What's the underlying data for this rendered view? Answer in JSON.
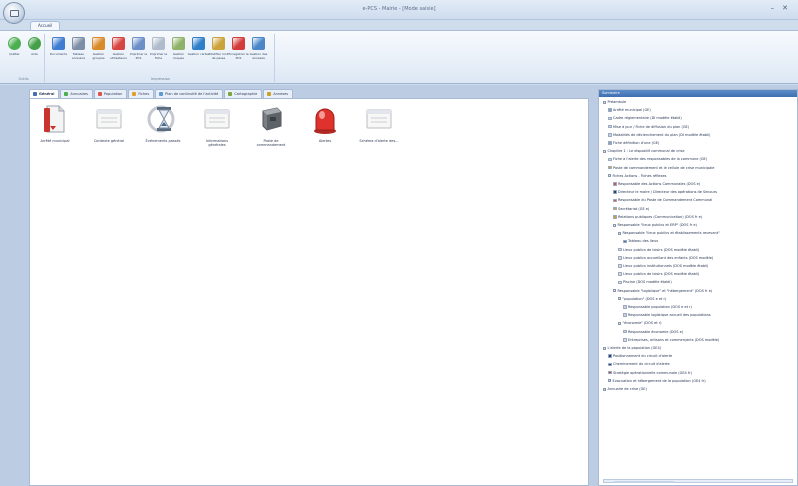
{
  "window": {
    "title": "e-PCS - Mairie - [Mode saisie]",
    "minimize": "–",
    "close": "✕"
  },
  "ribbon": {
    "tab_label": "Accueil",
    "groups": [
      {
        "title": "Outils",
        "buttons": [
          {
            "label": "Quitter",
            "icon": "exit-icon",
            "color": "#4caf50"
          },
          {
            "label": "Aide",
            "icon": "help-icon",
            "color": "#43a047"
          }
        ]
      },
      {
        "title": "Impression",
        "buttons": [
          {
            "label": "Documents",
            "icon": "documents-icon",
            "color": "#3f7dd1"
          },
          {
            "label": "Tableau annuaire",
            "icon": "directory-icon",
            "color": "#7e8ea6"
          },
          {
            "label": "Gestion groupes",
            "icon": "groups-icon",
            "color": "#d98b2b"
          },
          {
            "label": "Gestion utilisateurs",
            "icon": "users-icon",
            "color": "#d64541"
          },
          {
            "label": "Imprimer le PCS",
            "icon": "print-icon",
            "color": "#6d8fc7"
          },
          {
            "label": "Imprimer la fiche",
            "icon": "print-sheet-icon",
            "color": "#b0bccb"
          },
          {
            "label": "Gestion risques",
            "icon": "risks-icon",
            "color": "#8fb26a"
          },
          {
            "label": "Gestion cartes",
            "icon": "maps-icon",
            "color": "#2f7fc9"
          },
          {
            "label": "Modifier mot de passe",
            "icon": "password-icon",
            "color": "#caa43a"
          },
          {
            "label": "Enregistrer le PCS",
            "icon": "save-pcs-icon",
            "color": "#d33b3b"
          },
          {
            "label": "Gestion des annexes",
            "icon": "annexes-icon",
            "color": "#4a86c8"
          }
        ]
      }
    ]
  },
  "doc_tabs": [
    {
      "label": "Général",
      "color": "#3f6fb0",
      "active": true
    },
    {
      "label": "Annuaires",
      "color": "#4caf50",
      "active": false
    },
    {
      "label": "Population",
      "color": "#d9534f",
      "active": false
    },
    {
      "label": "Fiches",
      "color": "#e0a030",
      "active": false
    },
    {
      "label": "Plan de continuité de l'activité",
      "color": "#5b9bd5",
      "active": false
    },
    {
      "label": "Cartographie",
      "color": "#7aa63c",
      "active": false
    },
    {
      "label": "Annexes",
      "color": "#c9a227",
      "active": false
    }
  ],
  "grid_items": [
    {
      "label": "Arrêté municipal",
      "icon": "decree-icon"
    },
    {
      "label": "Contexte général",
      "icon": "context-icon"
    },
    {
      "label": "Événements passés",
      "icon": "hourglass-icon"
    },
    {
      "label": "Informations générales",
      "icon": "info-icon"
    },
    {
      "label": "Poste de commandement",
      "icon": "command-post-icon"
    },
    {
      "label": "Alertes",
      "icon": "alert-siren-icon"
    },
    {
      "label": "Schéma d'alerte des...",
      "icon": "alert-scheme-icon"
    }
  ],
  "panel": {
    "title": "Sommaire",
    "tree": [
      {
        "level": 0,
        "label": "Préambule",
        "exp": "−"
      },
      {
        "level": 1,
        "label": "Arrêté municipal (GE)",
        "c": "#8aa0bf"
      },
      {
        "level": 1,
        "label": "Cadre réglementaire (DI modèle établi)",
        "c": "#c8d3e3"
      },
      {
        "level": 1,
        "label": "Mise à jour / Fiche de diffusion du plan (GE)",
        "c": "#c8d3e3"
      },
      {
        "level": 1,
        "label": "Modalités de déclenchement du plan (DI modèle établi)",
        "c": "#c8d3e3"
      },
      {
        "level": 1,
        "label": "Fiche définition d'une (GE)",
        "c": "#8aa0bf"
      },
      {
        "level": 0,
        "label": "Chapitre 1 : Le dispositif communal de crise",
        "exp": "−"
      },
      {
        "level": 1,
        "label": "Fiche à l'alerte des responsables de la commune (GE)",
        "c": "#c8d3e3"
      },
      {
        "level": 1,
        "label": "Poste de commandement et le cellule de crise municipale",
        "c": "#e0a030"
      },
      {
        "level": 1,
        "label": "Fiches Actions - Fiches réflexes",
        "exp": "−"
      },
      {
        "level": 2,
        "label": "Responsable des Actions Communales (DOS e)",
        "c": "#d9534f"
      },
      {
        "level": 2,
        "label": "Directeur le maire / Directeur des opérations de Secours",
        "c": "#1f3f7a"
      },
      {
        "level": 2,
        "label": "Responsable du Poste de Commandement Communal",
        "c": "#d9534f"
      },
      {
        "level": 2,
        "label": "Secrétariat (GE e)",
        "c": "#e0a030"
      },
      {
        "level": 2,
        "label": "Relations publiques (Communication) (DOS fr e)",
        "c": "#c8a040"
      },
      {
        "level": 2,
        "label": "Responsable \"lieux publics et ERP\" (DOS fr e)",
        "exp": "−"
      },
      {
        "level": 3,
        "label": "Responsable \"lieux publics et établissements recevant\"",
        "exp": "−"
      },
      {
        "level": 4,
        "label": "Tableau des lieux",
        "c": "#3f6fb0"
      },
      {
        "level": 3,
        "label": "Lieux publics de loisirs (DOS modèle établi)"
      },
      {
        "level": 3,
        "label": "Lieux publics accueillant des enfants (DOS modèle)"
      },
      {
        "level": 3,
        "label": "Lieux publics institutionnels (DOS modèle établi)"
      },
      {
        "level": 3,
        "label": "Lieux publics de loisirs (DOS modèle établi)"
      },
      {
        "level": 3,
        "label": "Piscine (DOS modèle établi)"
      },
      {
        "level": 2,
        "label": "Responsable \"logistique\" et \"hébergement\" (DOS fr e)",
        "exp": "−"
      },
      {
        "level": 3,
        "label": "\"population\" (DOS e et r)",
        "exp": "−"
      },
      {
        "level": 4,
        "label": "Responsable population (DOS e et r)",
        "c": "#c8d3e3"
      },
      {
        "level": 4,
        "label": "Responsable logistique accueil des populations",
        "c": "#c8d3e3"
      },
      {
        "level": 3,
        "label": "\"économie\" (DOS et r)",
        "exp": "−"
      },
      {
        "level": 4,
        "label": "Responsable économie (DOS e)",
        "c": "#c8d3e3"
      },
      {
        "level": 4,
        "label": "Entreprises, artisans et commerçants (DOS modèle)"
      },
      {
        "level": 0,
        "label": "L'alerte de la population (GE4)",
        "exp": "−"
      },
      {
        "level": 1,
        "label": "Positionnement du circuit d'alerte",
        "c": "#1f3f7a"
      },
      {
        "level": 1,
        "label": "Cheminement du circuit d'alerte",
        "c": "#1f3f7a"
      },
      {
        "level": 1,
        "label": "Stratégie opérationnelle communale (GE4 fr)",
        "c": "#d33b3b"
      },
      {
        "level": 1,
        "label": "Evacuation et hébergement de la population (GE4 fr)",
        "exp": "+"
      },
      {
        "level": 0,
        "label": "Annuaire de crise (GE)",
        "exp": "+"
      }
    ]
  }
}
